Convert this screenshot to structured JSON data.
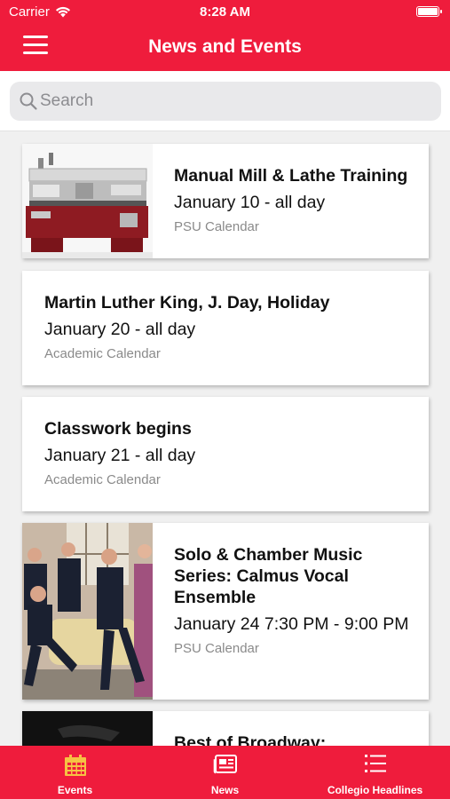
{
  "status_bar": {
    "carrier": "Carrier",
    "time": "8:28 AM"
  },
  "nav": {
    "title": "News and Events",
    "menu_icon": "hamburger-menu-icon"
  },
  "search": {
    "placeholder": "Search"
  },
  "events": [
    {
      "title": "Manual Mill & Lathe Training",
      "date": "January 10 - all day",
      "source": "PSU Calendar"
    },
    {
      "title": "Martin Luther King, J. Day, Holiday",
      "date": "January 20 - all day",
      "source": "Academic Calendar"
    },
    {
      "title": "Classwork begins",
      "date": "January 21 - all day",
      "source": "Academic Calendar"
    },
    {
      "title": "Solo & Chamber Music Series: Calmus Vocal Ensemble",
      "date": "January 24 7:30 PM - 9:00 PM",
      "source": "PSU Calendar"
    },
    {
      "title": "Best of Broadway:"
    }
  ],
  "tabs": [
    {
      "label": "Events",
      "icon": "calendar-icon",
      "active": true,
      "color": "#f6c244"
    },
    {
      "label": "News",
      "icon": "newspaper-icon",
      "active": false,
      "color": "#ffffff"
    },
    {
      "label": "Collegio Headlines",
      "icon": "list-icon",
      "active": false,
      "color": "#ffffff"
    }
  ],
  "colors": {
    "brand": "#ef1c3c",
    "active_tab": "#f6c244",
    "background": "#f0f0f0"
  }
}
